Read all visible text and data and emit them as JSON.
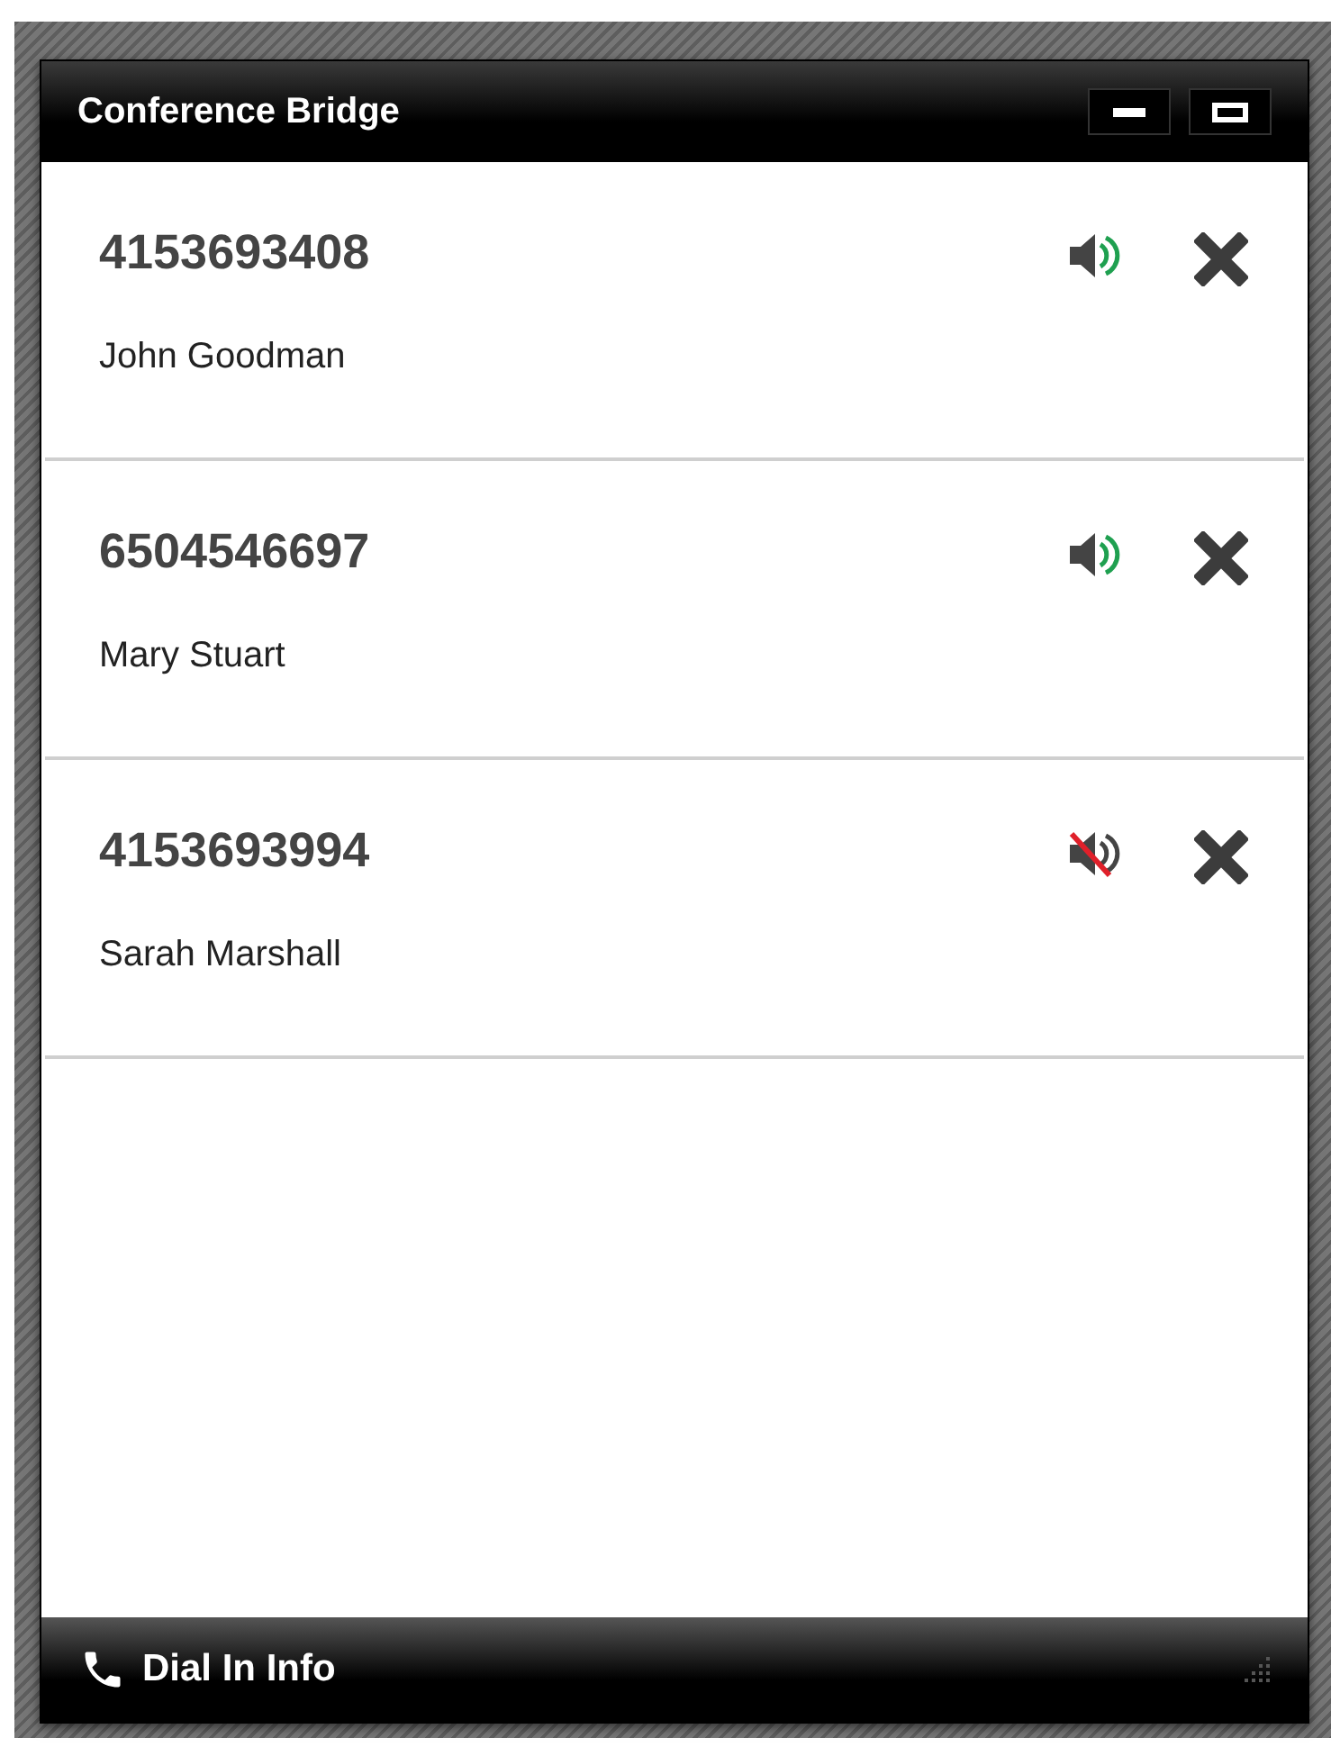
{
  "window": {
    "title": "Conference Bridge"
  },
  "participants": [
    {
      "number": "4153693408",
      "name": "John Goodman",
      "muted": false
    },
    {
      "number": "6504546697",
      "name": "Mary Stuart",
      "muted": false
    },
    {
      "number": "4153693994",
      "name": "Sarah Marshall",
      "muted": true
    }
  ],
  "footer": {
    "label": "Dial In Info"
  }
}
